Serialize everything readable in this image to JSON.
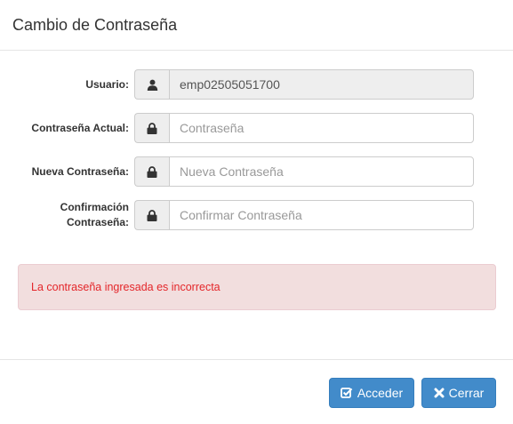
{
  "modal": {
    "title": "Cambio de Contraseña"
  },
  "form": {
    "usuario": {
      "label": "Usuario:",
      "value": "emp02505051700",
      "icon": "user-icon"
    },
    "actual": {
      "label": "Contraseña Actual:",
      "placeholder": "Contraseña",
      "icon": "lock-icon"
    },
    "nueva": {
      "label": "Nueva Contraseña:",
      "placeholder": "Nueva Contraseña",
      "icon": "lock-icon"
    },
    "confirmacion": {
      "label_line1": "Confirmación",
      "label_line2": "Contraseña:",
      "placeholder": "Confirmar Contraseña",
      "icon": "lock-icon"
    }
  },
  "alert": {
    "message": "La contraseña ingresada es incorrecta",
    "color": "#e4262a",
    "background": "#f2dede"
  },
  "footer": {
    "acceder_label": "Acceder",
    "acceder_icon": "check-square-icon",
    "cerrar_label": "Cerrar",
    "cerrar_icon": "close-icon",
    "button_color": "#428bca"
  }
}
